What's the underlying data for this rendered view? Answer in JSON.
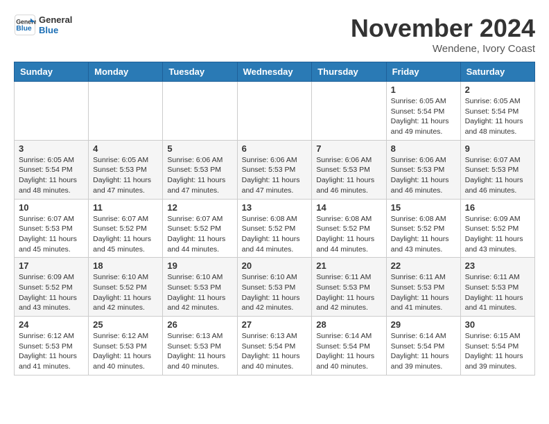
{
  "header": {
    "logo_line1": "General",
    "logo_line2": "Blue",
    "month": "November 2024",
    "location": "Wendene, Ivory Coast"
  },
  "weekdays": [
    "Sunday",
    "Monday",
    "Tuesday",
    "Wednesday",
    "Thursday",
    "Friday",
    "Saturday"
  ],
  "weeks": [
    [
      {
        "day": "",
        "info": ""
      },
      {
        "day": "",
        "info": ""
      },
      {
        "day": "",
        "info": ""
      },
      {
        "day": "",
        "info": ""
      },
      {
        "day": "",
        "info": ""
      },
      {
        "day": "1",
        "info": "Sunrise: 6:05 AM\nSunset: 5:54 PM\nDaylight: 11 hours and 49 minutes."
      },
      {
        "day": "2",
        "info": "Sunrise: 6:05 AM\nSunset: 5:54 PM\nDaylight: 11 hours and 48 minutes."
      }
    ],
    [
      {
        "day": "3",
        "info": "Sunrise: 6:05 AM\nSunset: 5:54 PM\nDaylight: 11 hours and 48 minutes."
      },
      {
        "day": "4",
        "info": "Sunrise: 6:05 AM\nSunset: 5:53 PM\nDaylight: 11 hours and 47 minutes."
      },
      {
        "day": "5",
        "info": "Sunrise: 6:06 AM\nSunset: 5:53 PM\nDaylight: 11 hours and 47 minutes."
      },
      {
        "day": "6",
        "info": "Sunrise: 6:06 AM\nSunset: 5:53 PM\nDaylight: 11 hours and 47 minutes."
      },
      {
        "day": "7",
        "info": "Sunrise: 6:06 AM\nSunset: 5:53 PM\nDaylight: 11 hours and 46 minutes."
      },
      {
        "day": "8",
        "info": "Sunrise: 6:06 AM\nSunset: 5:53 PM\nDaylight: 11 hours and 46 minutes."
      },
      {
        "day": "9",
        "info": "Sunrise: 6:07 AM\nSunset: 5:53 PM\nDaylight: 11 hours and 46 minutes."
      }
    ],
    [
      {
        "day": "10",
        "info": "Sunrise: 6:07 AM\nSunset: 5:53 PM\nDaylight: 11 hours and 45 minutes."
      },
      {
        "day": "11",
        "info": "Sunrise: 6:07 AM\nSunset: 5:52 PM\nDaylight: 11 hours and 45 minutes."
      },
      {
        "day": "12",
        "info": "Sunrise: 6:07 AM\nSunset: 5:52 PM\nDaylight: 11 hours and 44 minutes."
      },
      {
        "day": "13",
        "info": "Sunrise: 6:08 AM\nSunset: 5:52 PM\nDaylight: 11 hours and 44 minutes."
      },
      {
        "day": "14",
        "info": "Sunrise: 6:08 AM\nSunset: 5:52 PM\nDaylight: 11 hours and 44 minutes."
      },
      {
        "day": "15",
        "info": "Sunrise: 6:08 AM\nSunset: 5:52 PM\nDaylight: 11 hours and 43 minutes."
      },
      {
        "day": "16",
        "info": "Sunrise: 6:09 AM\nSunset: 5:52 PM\nDaylight: 11 hours and 43 minutes."
      }
    ],
    [
      {
        "day": "17",
        "info": "Sunrise: 6:09 AM\nSunset: 5:52 PM\nDaylight: 11 hours and 43 minutes."
      },
      {
        "day": "18",
        "info": "Sunrise: 6:10 AM\nSunset: 5:52 PM\nDaylight: 11 hours and 42 minutes."
      },
      {
        "day": "19",
        "info": "Sunrise: 6:10 AM\nSunset: 5:53 PM\nDaylight: 11 hours and 42 minutes."
      },
      {
        "day": "20",
        "info": "Sunrise: 6:10 AM\nSunset: 5:53 PM\nDaylight: 11 hours and 42 minutes."
      },
      {
        "day": "21",
        "info": "Sunrise: 6:11 AM\nSunset: 5:53 PM\nDaylight: 11 hours and 42 minutes."
      },
      {
        "day": "22",
        "info": "Sunrise: 6:11 AM\nSunset: 5:53 PM\nDaylight: 11 hours and 41 minutes."
      },
      {
        "day": "23",
        "info": "Sunrise: 6:11 AM\nSunset: 5:53 PM\nDaylight: 11 hours and 41 minutes."
      }
    ],
    [
      {
        "day": "24",
        "info": "Sunrise: 6:12 AM\nSunset: 5:53 PM\nDaylight: 11 hours and 41 minutes."
      },
      {
        "day": "25",
        "info": "Sunrise: 6:12 AM\nSunset: 5:53 PM\nDaylight: 11 hours and 40 minutes."
      },
      {
        "day": "26",
        "info": "Sunrise: 6:13 AM\nSunset: 5:53 PM\nDaylight: 11 hours and 40 minutes."
      },
      {
        "day": "27",
        "info": "Sunrise: 6:13 AM\nSunset: 5:54 PM\nDaylight: 11 hours and 40 minutes."
      },
      {
        "day": "28",
        "info": "Sunrise: 6:14 AM\nSunset: 5:54 PM\nDaylight: 11 hours and 40 minutes."
      },
      {
        "day": "29",
        "info": "Sunrise: 6:14 AM\nSunset: 5:54 PM\nDaylight: 11 hours and 39 minutes."
      },
      {
        "day": "30",
        "info": "Sunrise: 6:15 AM\nSunset: 5:54 PM\nDaylight: 11 hours and 39 minutes."
      }
    ]
  ]
}
